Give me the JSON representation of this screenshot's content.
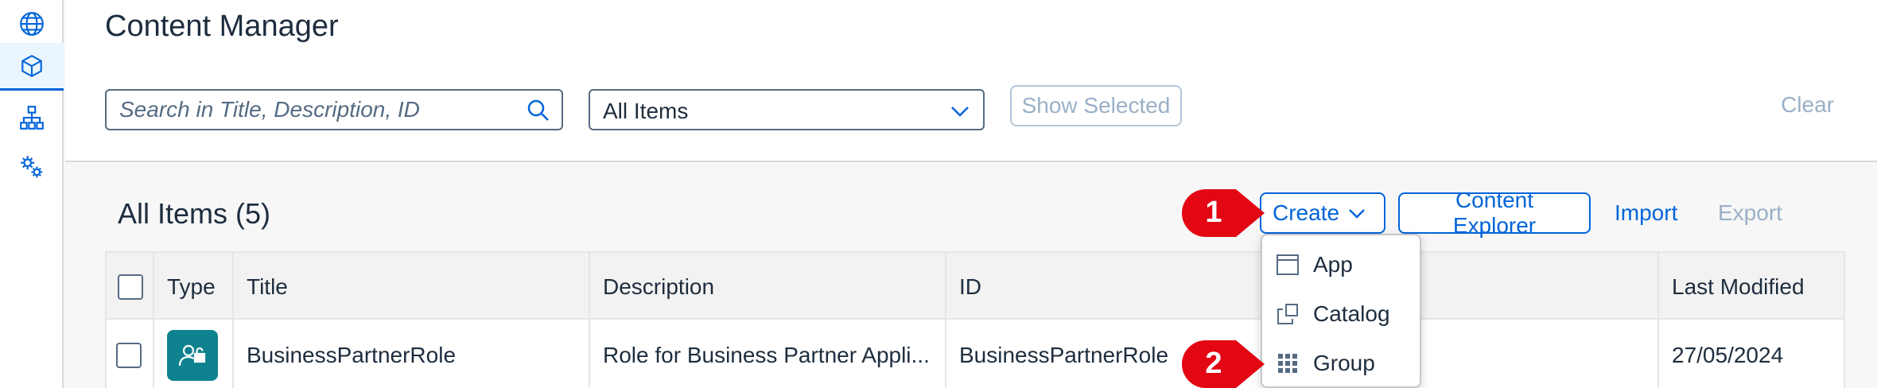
{
  "nav": {
    "items": [
      {
        "icon": "globe-icon"
      },
      {
        "icon": "content-cube-icon",
        "active": true
      },
      {
        "icon": "hierarchy-icon"
      },
      {
        "icon": "settings-gears-icon"
      }
    ]
  },
  "header": {
    "title": "Content Manager",
    "search_placeholder": "Search in Title, Description, ID",
    "filter_value": "All Items",
    "show_selected_label": "Show Selected",
    "clear_label": "Clear"
  },
  "toolbar": {
    "table_title": "All Items (5)",
    "create_label": "Create",
    "content_explorer_label": "Content Explorer",
    "import_label": "Import",
    "export_label": "Export"
  },
  "callouts": [
    "1",
    "2"
  ],
  "table": {
    "columns": [
      "Type",
      "Title",
      "Description",
      "ID",
      "Last Modified"
    ],
    "rows": [
      {
        "type_icon": "role-lock-icon",
        "title": "BusinessPartnerRole",
        "description": "Role for Business Partner Appli...",
        "id": "BusinessPartnerRole",
        "last_modified": "27/05/2024"
      }
    ]
  },
  "create_menu": {
    "items": [
      {
        "label": "App",
        "icon": "app-window-icon"
      },
      {
        "label": "Catalog",
        "icon": "catalog-icon"
      },
      {
        "label": "Group",
        "icon": "group-grid-icon"
      }
    ]
  },
  "colors": {
    "accent": "#0064d9",
    "callout": "#e30613",
    "type_tile": "#0f828f"
  }
}
